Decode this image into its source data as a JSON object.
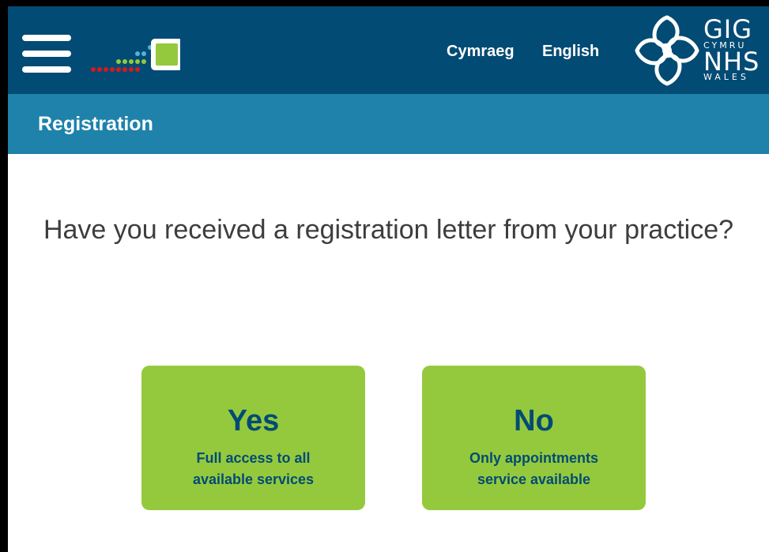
{
  "header": {
    "menu_icon": "hamburger-menu-icon",
    "app_logo_icon": "app-logo-dots-square",
    "languages": [
      {
        "label": "Cymraeg"
      },
      {
        "label": "English"
      }
    ],
    "nhs_logo": {
      "emblem_icon": "celtic-knot-emblem",
      "line1": "GIG",
      "line2": "CYMRU",
      "line3": "NHS",
      "line4": "WALES"
    },
    "colors": {
      "header_bg": "#024b74",
      "subheader_bg": "#1e82ab"
    }
  },
  "subheader": {
    "title": "Registration"
  },
  "main": {
    "question": "Have you received a registration letter from your practice?",
    "options": [
      {
        "title": "Yes",
        "subtitle_line1": "Full access to all",
        "subtitle_line2": "available services"
      },
      {
        "title": "No",
        "subtitle_line1": "Only appointments",
        "subtitle_line2": "service available"
      }
    ],
    "colors": {
      "button_bg": "#95c93d",
      "button_text": "#024b74"
    }
  }
}
